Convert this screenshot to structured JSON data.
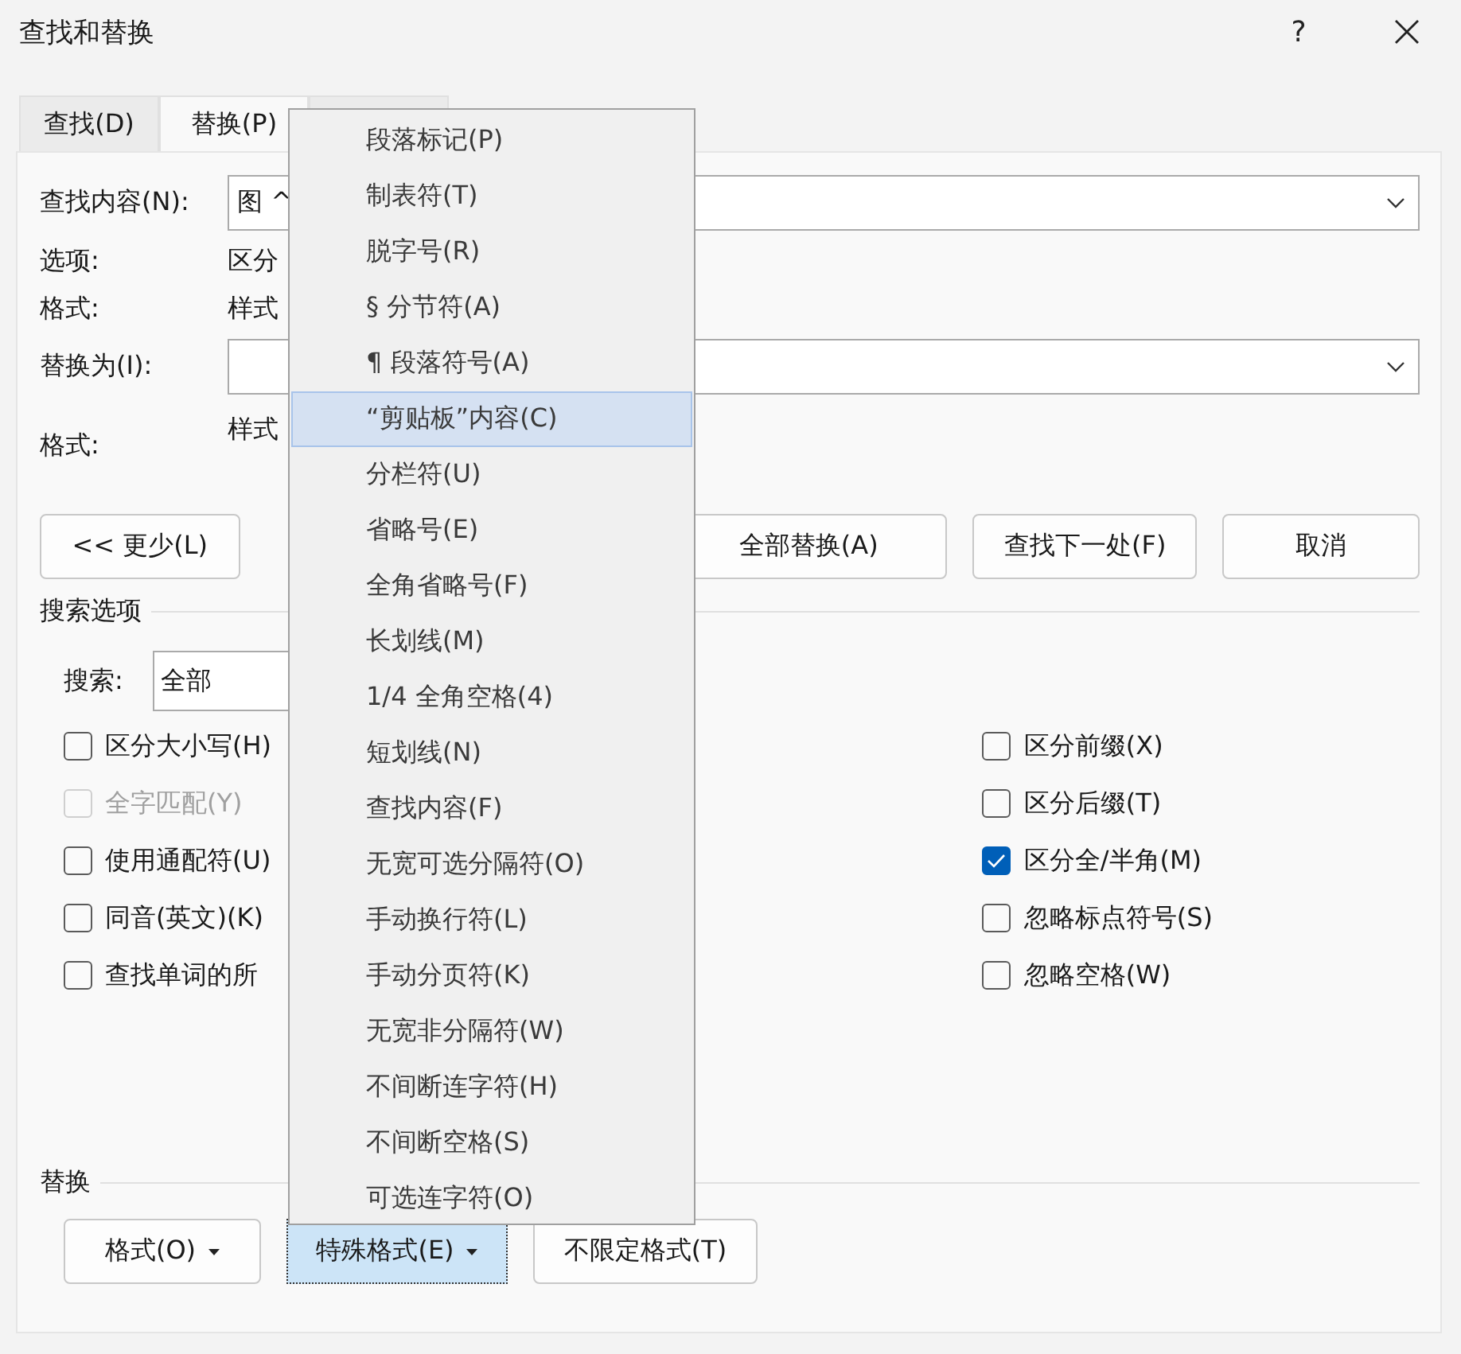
{
  "window": {
    "title": "查找和替换",
    "help": "?"
  },
  "tabs": [
    {
      "label": "查找(D)",
      "selected": false
    },
    {
      "label": "替换(P)",
      "selected": true
    },
    {
      "selected": false
    }
  ],
  "find": {
    "label": "查找内容(N):",
    "value": "图 ^"
  },
  "find_info": [
    {
      "label": "选项:",
      "value": "区分"
    },
    {
      "label": "格式:",
      "value": "样式"
    }
  ],
  "replace": {
    "label": "替换为(I):"
  },
  "replace_format": {
    "label": "格式:",
    "value": "样式"
  },
  "action_buttons": [
    "<< 更少(L)",
    "全部替换(A)",
    "查找下一处(F)",
    "取消"
  ],
  "search_options": {
    "title": "搜索选项",
    "search_label": "搜索:",
    "search_value": "全部",
    "left": [
      {
        "label": "区分大小写(H)",
        "checked": false,
        "disabled": false
      },
      {
        "label": "全字匹配(Y)",
        "checked": false,
        "disabled": true
      },
      {
        "label": "使用通配符(U)",
        "checked": false,
        "disabled": false
      },
      {
        "label": "同音(英文)(K)",
        "checked": false,
        "disabled": false
      },
      {
        "label": "查找单词的所",
        "checked": false,
        "disabled": false
      }
    ],
    "right": [
      {
        "label": "区分前缀(X)",
        "checked": false,
        "disabled": false
      },
      {
        "label": "区分后缀(T)",
        "checked": false,
        "disabled": false
      },
      {
        "label": "区分全/半角(M)",
        "checked": true,
        "disabled": false
      },
      {
        "label": "忽略标点符号(S)",
        "checked": false,
        "disabled": false
      },
      {
        "label": "忽略空格(W)",
        "checked": false,
        "disabled": false
      }
    ]
  },
  "replace_section": {
    "title": "替换",
    "buttons": [
      {
        "label": "格式(O)",
        "dropdown": true,
        "pressed": false
      },
      {
        "label": "特殊格式(E)",
        "dropdown": true,
        "pressed": true
      },
      {
        "label": "不限定格式(T)",
        "dropdown": false,
        "pressed": false
      }
    ]
  },
  "menu": {
    "items": [
      {
        "label": "段落标记(P)",
        "selected": false
      },
      {
        "label": "制表符(T)",
        "selected": false
      },
      {
        "label": "脱字号(R)",
        "selected": false
      },
      {
        "label": "§ 分节符(A)",
        "selected": false
      },
      {
        "label": "¶ 段落符号(A)",
        "selected": false
      },
      {
        "label": "“剪贴板”内容(C)",
        "selected": true
      },
      {
        "label": "分栏符(U)",
        "selected": false
      },
      {
        "label": "省略号(E)",
        "selected": false
      },
      {
        "label": "全角省略号(F)",
        "selected": false
      },
      {
        "label": "长划线(M)",
        "selected": false
      },
      {
        "label": "1/4 全角空格(4)",
        "selected": false
      },
      {
        "label": "短划线(N)",
        "selected": false
      },
      {
        "label": "查找内容(F)",
        "selected": false
      },
      {
        "label": "无宽可选分隔符(O)",
        "selected": false
      },
      {
        "label": "手动换行符(L)",
        "selected": false
      },
      {
        "label": "手动分页符(K)",
        "selected": false
      },
      {
        "label": "无宽非分隔符(W)",
        "selected": false
      },
      {
        "label": "不间断连字符(H)",
        "selected": false
      },
      {
        "label": "不间断空格(S)",
        "selected": false
      },
      {
        "label": "可选连字符(O)",
        "selected": false
      }
    ]
  }
}
